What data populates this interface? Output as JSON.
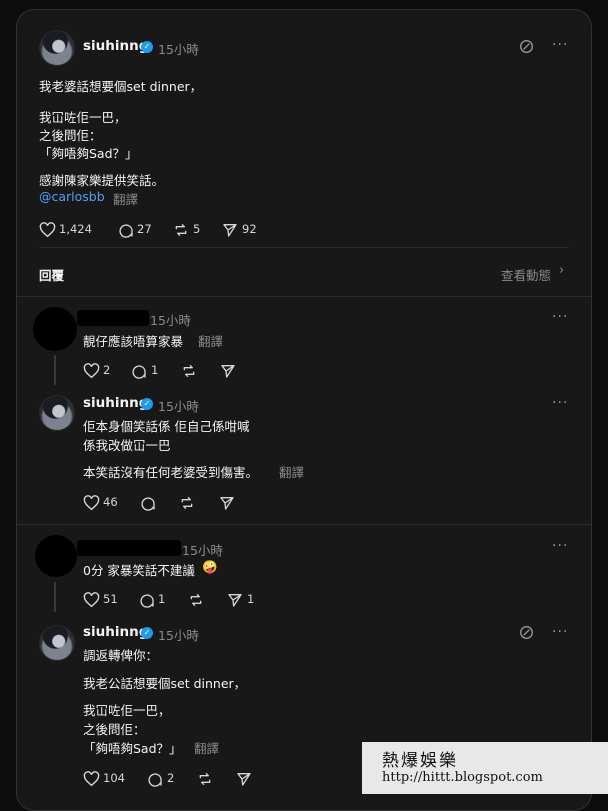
{
  "main_post": {
    "username": "siuhinng",
    "time": "15小時",
    "lines": [
      "我老婆話想要個set dinner，",
      "我冚咗佢一巴，",
      "之後問佢：",
      "「夠唔夠Sad？」",
      "感謝陳家樂提供笑話。"
    ],
    "mention": "@carlosbb",
    "translate": "翻譯",
    "likes": "1,424",
    "comments": "27",
    "reposts": "5",
    "shares": "92"
  },
  "replies_header": {
    "label": "回覆",
    "view_activity": "查看動態"
  },
  "reply1": {
    "time": "15小時",
    "text": "靚仔應該唔算家暴",
    "translate": "翻譯",
    "likes": "2",
    "comments": "1"
  },
  "reply1_response": {
    "username": "siuhinng",
    "time": "15小時",
    "lines": [
      "佢本身個笑話係 佢自己係咁喊",
      "係我改做冚一巴"
    ],
    "note": "本笑話沒有任何老婆受到傷害。",
    "translate": "翻譯",
    "likes": "46"
  },
  "reply2": {
    "time": "15小時",
    "text": "0分 家暴笑話不建議",
    "emoji": "🤪",
    "likes": "51",
    "comments": "1",
    "shares": "1"
  },
  "reply2_response": {
    "username": "siuhinng",
    "time": "15小時",
    "intro": "調返轉俾你：",
    "lines": [
      "我老公話想要個set dinner，",
      "我冚咗佢一巴，",
      "之後問佢：",
      "「夠唔夠Sad？」"
    ],
    "translate": "翻譯",
    "likes": "104",
    "comments": "2"
  },
  "watermark": {
    "line1": "熱爆娛樂",
    "line2": "http://hittt.blogspot.com"
  }
}
